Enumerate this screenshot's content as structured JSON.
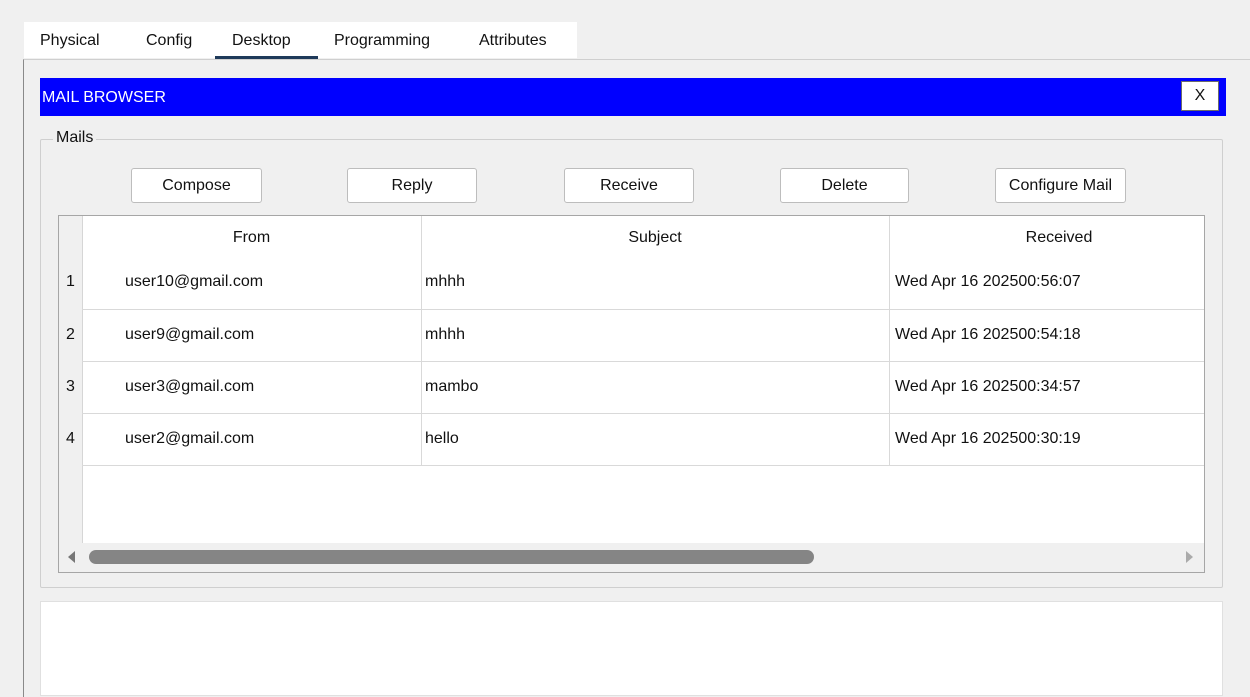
{
  "tabs": [
    "Physical",
    "Config",
    "Desktop",
    "Programming",
    "Attributes"
  ],
  "active_tab": "Desktop",
  "window": {
    "title": "MAIL BROWSER",
    "close_label": "X"
  },
  "mails_group": {
    "label": "Mails"
  },
  "buttons": {
    "compose": "Compose",
    "reply": "Reply",
    "receive": "Receive",
    "delete": "Delete",
    "configure": "Configure Mail"
  },
  "table": {
    "columns": [
      "From",
      "Subject",
      "Received"
    ],
    "rows": [
      {
        "num": "1",
        "from": "user10@gmail.com",
        "subject": "mhhh",
        "received": "Wed Apr 16 202500:56:07"
      },
      {
        "num": "2",
        "from": "user9@gmail.com",
        "subject": "mhhh",
        "received": "Wed Apr 16 202500:54:18"
      },
      {
        "num": "3",
        "from": "user3@gmail.com",
        "subject": "mambo",
        "received": "Wed Apr 16 202500:34:57"
      },
      {
        "num": "4",
        "from": "user2@gmail.com",
        "subject": "hello",
        "received": "Wed Apr 16 202500:30:19"
      }
    ]
  },
  "colors": {
    "title_bar": "#0000ff",
    "active_tab_underline": "#1f3a5a"
  }
}
